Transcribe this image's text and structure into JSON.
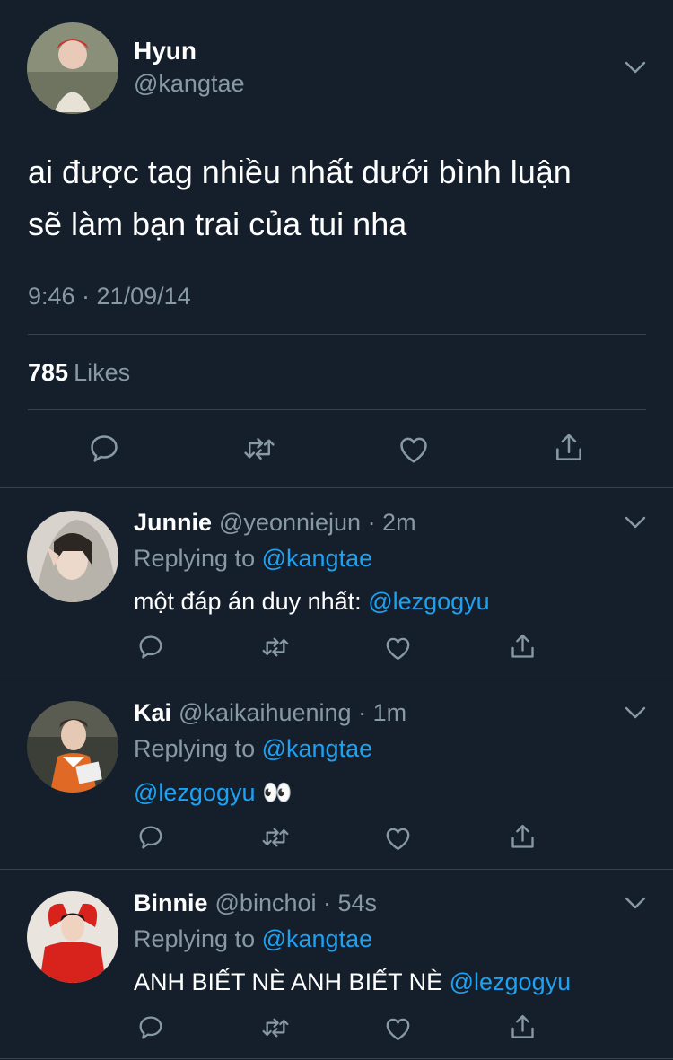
{
  "tweet": {
    "name": "Hyun",
    "handle": "@kangtae",
    "text_line1": "ai được tag nhiều nhất dưới bình luận",
    "text_line2": "sẽ làm bạn trai của tui nha",
    "timestamp": "9:46 · 21/09/14",
    "likes_count": "785",
    "likes_label": "Likes"
  },
  "replies": [
    {
      "name": "Junnie",
      "handle": "@yeonniejun",
      "time": "· 2m",
      "replying_label": "Replying to",
      "replying_to": "@kangtae",
      "text": "một đáp án duy nhất:",
      "mention": "@lezgogyu",
      "emoji": ""
    },
    {
      "name": "Kai",
      "handle": "@kaikaihuening",
      "time": "· 1m",
      "replying_label": "Replying to",
      "replying_to": "@kangtae",
      "text": "",
      "mention": "@lezgogyu",
      "emoji": "👀"
    },
    {
      "name": "Binnie",
      "handle": "@binchoi",
      "time": "· 54s",
      "replying_label": "Replying to",
      "replying_to": "@kangtae",
      "text": "ANH BIẾT NÈ ANH BIẾT NÈ",
      "mention": "@lezgogyu",
      "emoji": ""
    }
  ],
  "colors": {
    "background": "#151f2b",
    "secondary_text": "#8899a6",
    "link": "#1da1f2",
    "divider": "#38444d"
  },
  "icons": [
    "chevron-down-icon",
    "reply-icon",
    "retweet-icon",
    "like-icon",
    "share-icon"
  ]
}
